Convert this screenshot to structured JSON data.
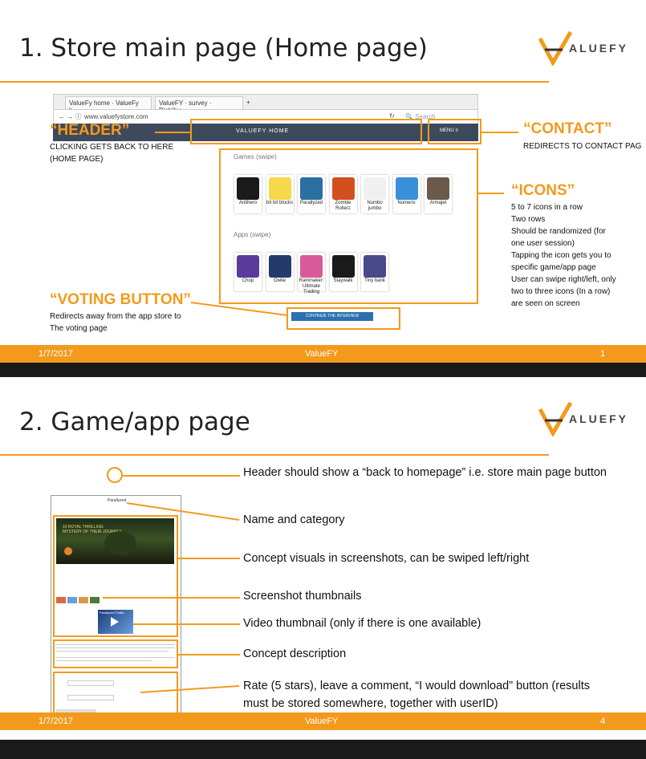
{
  "slide1": {
    "title": "1. Store main page (Home page)",
    "footer": {
      "date": "1/7/2017",
      "center": "ValueFY",
      "page": "1"
    },
    "browser": {
      "tab1": "ValueFy home · ValueFy h...",
      "tab2": "ValueFY · survey · Distribu...",
      "url": "www.valuefystore.com",
      "search_placeholder": "Search"
    },
    "store_header": {
      "title": "VALUEFY HOME",
      "menu": "MENU ≡"
    },
    "games_label": "Games (swipe)",
    "apps_label": "Apps (swipe)",
    "games": [
      {
        "label": "Antihero",
        "color": "#1a1a1a"
      },
      {
        "label": "bit bit blocks",
        "color": "#f6d84a"
      },
      {
        "label": "Parallyzed",
        "color": "#2b6fa0"
      },
      {
        "label": "Zombie Rollerz",
        "color": "#d44f1f"
      },
      {
        "label": "Numbo jumbo",
        "color": "#f0f0f0"
      },
      {
        "label": "Numeris",
        "color": "#3a8fd8"
      },
      {
        "label": "Armajet",
        "color": "#6b5a4a"
      }
    ],
    "apps": [
      {
        "label": "Chop",
        "color": "#5a3a9a"
      },
      {
        "label": "Owlie",
        "color": "#243a6a"
      },
      {
        "label": "Rainmaker: Ultimate Trading",
        "color": "#d85a9a"
      },
      {
        "label": "Staywalk",
        "color": "#1a1a1a"
      },
      {
        "label": "Tiny bank",
        "color": "#4a4a8a"
      }
    ],
    "vote_button": "CONTINUE THE INTERVIEW",
    "callouts": {
      "header_title": "“HEADER”",
      "header_text": "CLICKING GETS BACK TO HERE\n(HOME PAGE)",
      "contact_title": "“CONTACT”",
      "contact_text": "REDIRECTS TO CONTACT PAG",
      "icons_title": "“ICONS”",
      "icons_text": "5 to 7 icons in a row\nTwo rows\nShould be randomized (for\none user session)\nTapping the icon gets you to\nspecific game/app page\nUser can swipe right/left, only\ntwo to three icons (In a row)\nare seen on screen",
      "voting_title": "“VOTING BUTTON”",
      "voting_text": "Redirects away from the app store to\nThe voting page"
    }
  },
  "slide2": {
    "title": "2. Game/app page",
    "footer": {
      "date": "1/7/2017",
      "center": "ValueFY",
      "page": "4"
    },
    "phone": {
      "game_name": "Parallyzed",
      "screenshot_caption": "10 ROYAL THRILLING\nMYSTERY OF THEIR JOURNEY",
      "video_label": "Parallyzed Trailer"
    },
    "annotations": [
      "Header should show a “back to homepage” i.e. store main page button",
      "Name and category",
      "Concept visuals in screenshots, can be swiped left/right",
      "Screenshot thumbnails",
      "Video thumbnail (only if there is one available)",
      "Concept description",
      "Rate (5 stars), leave a comment, “I would download” button (results must be stored somewhere, together with userID)"
    ]
  },
  "logo": {
    "letter": "V",
    "text": "ALUEFY",
    "accent": "#f39a1c"
  },
  "colors": {
    "accent": "#f39a1c",
    "store_header": "#3d4a5c",
    "vote_button": "#2d6fb1"
  }
}
